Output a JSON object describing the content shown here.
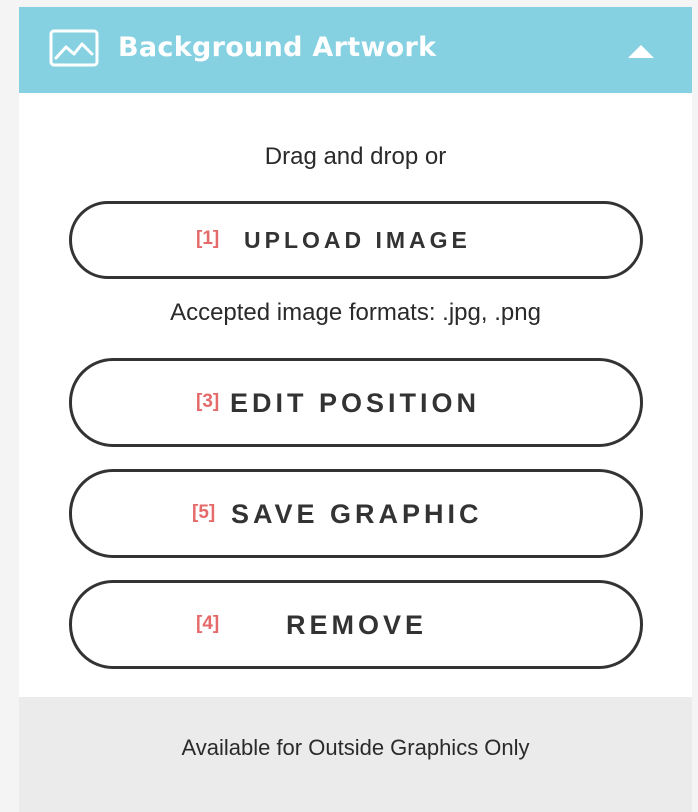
{
  "header": {
    "title": "Background Artwork",
    "icon": "image-icon",
    "toggle_icon": "caret-up-icon",
    "background_color": "#86d1e1"
  },
  "upload_area": {
    "drag_hint": "Drag and drop or",
    "formats_hint": "Accepted image formats: .jpg, .png"
  },
  "buttons": {
    "upload": {
      "marker": "[1]",
      "label": "UPLOAD IMAGE"
    },
    "edit": {
      "marker": "[3]",
      "label": "EDIT POSITION"
    },
    "save": {
      "marker": "[5]",
      "label": "SAVE GRAPHIC"
    },
    "remove": {
      "marker": "[4]",
      "label": "REMOVE"
    }
  },
  "footer": {
    "note": "Available for Outside Graphics Only"
  },
  "colors": {
    "marker": "#e56a6a",
    "button_border": "#333333"
  }
}
